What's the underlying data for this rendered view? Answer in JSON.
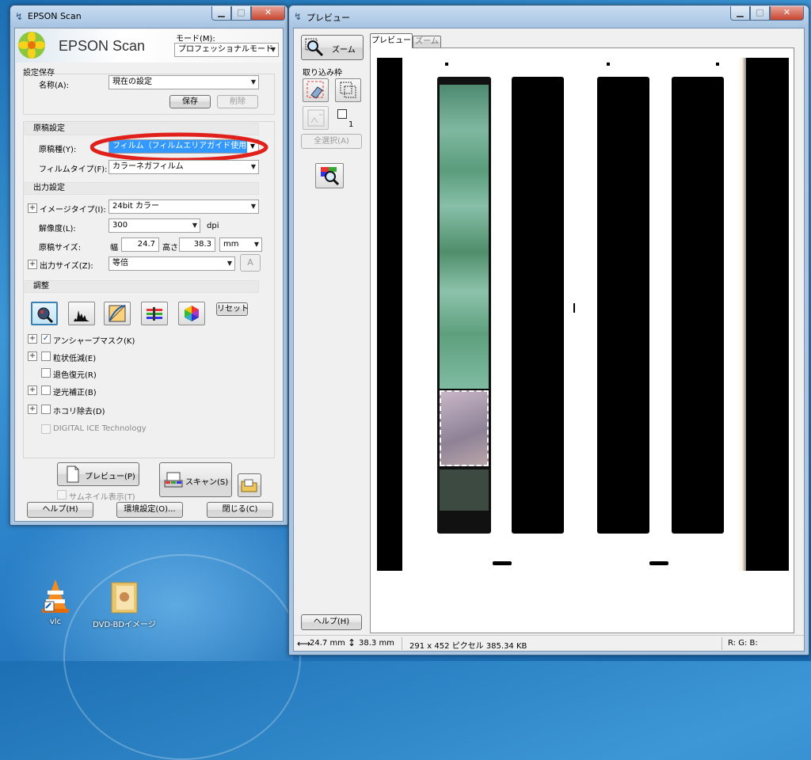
{
  "desktop": {
    "icons": [
      {
        "label": "vlc",
        "icon": "vlc-cone-icon"
      },
      {
        "label": "DVD-BDイメージ",
        "icon": "folder-icon"
      }
    ]
  },
  "scan_window": {
    "title": "EPSON Scan",
    "logo_text": "EPSON Scan",
    "mode_label": "モード(M):",
    "mode_value": "プロフェッショナルモード",
    "settings_save": {
      "header": "設定保存",
      "name_label": "名称(A):",
      "name_value": "現在の設定",
      "save": "保存",
      "delete": "削除"
    },
    "original": {
      "header": "原稿設定",
      "type_label": "原稿種(Y):",
      "type_value": "フィルム（フィルムエリアガイド使用）",
      "film_label": "フィルムタイプ(F):",
      "film_value": "カラーネガフィルム"
    },
    "output": {
      "header": "出力設定",
      "image_type_label": "イメージタイプ(I):",
      "image_type_value": "24bit カラー",
      "resolution_label": "解像度(L):",
      "resolution_value": "300",
      "resolution_unit": "dpi",
      "size_label": "原稿サイズ:",
      "width_label": "幅",
      "width_value": "24.7",
      "height_label": "高さ",
      "height_value": "38.3",
      "unit_value": "mm",
      "output_size_label": "出力サイズ(Z):",
      "output_size_value": "等倍",
      "output_size_btn": "A"
    },
    "adjust": {
      "header": "調整",
      "reset": "リセット",
      "tools": [
        "auto-exposure-icon",
        "histogram-icon",
        "tone-curve-icon",
        "color-balance-icon",
        "color-palette-icon"
      ],
      "options": [
        {
          "label": "アンシャープマスク(K)",
          "checked": "✓",
          "expand": "+"
        },
        {
          "label": "粒状低減(E)",
          "checked": "",
          "expand": "+"
        },
        {
          "label": "退色復元(R)",
          "checked": "",
          "expand": ""
        },
        {
          "label": "逆光補正(B)",
          "checked": "",
          "expand": "+"
        },
        {
          "label": "ホコリ除去(D)",
          "checked": "",
          "expand": "+"
        },
        {
          "label": "DIGITAL ICE Technology",
          "checked": "",
          "expand": ""
        }
      ]
    },
    "buttons": {
      "preview": "プレビュー(P)",
      "scan": "スキャン(S)",
      "thumbnail": "サムネイル表示(T)",
      "help": "ヘルプ(H)",
      "environment": "環境設定(O)...",
      "close": "閉じる(C)"
    }
  },
  "preview_window": {
    "title": "プレビュー",
    "zoom_btn": "ズーム",
    "capture_label": "取り込み枠",
    "frame_count": "1",
    "select_all": "全選択(A)",
    "help": "ヘルプ(H)",
    "tabs": [
      "プレビュー",
      "ズーム"
    ],
    "status": {
      "width": "24.7 mm",
      "height": "38.3 mm",
      "info": "291 x 452 ピクセル 385.34 KB",
      "rgb": "R: G: B:"
    }
  },
  "colors": {
    "accent_select": "#3399ff",
    "highlight_circle": "#e0201a",
    "titlebar": "#b9d1ea"
  }
}
